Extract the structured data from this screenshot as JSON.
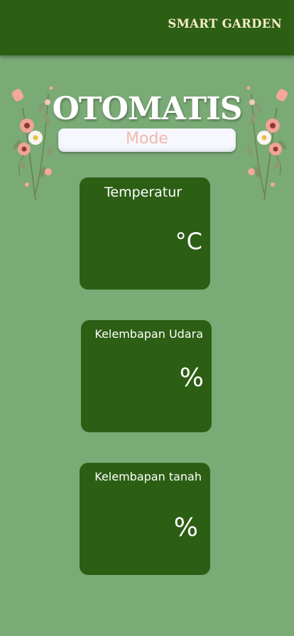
{
  "app_bar": {
    "title": "SMART GARDEN"
  },
  "mode": {
    "title": "OTOMATIS",
    "badge_label": "Mode"
  },
  "cards": [
    {
      "label": "Temperatur",
      "unit": "°C"
    },
    {
      "label": "Kelembapan Udara",
      "unit": "%"
    },
    {
      "label": "Kelembapan tanah",
      "unit": "%"
    }
  ],
  "colors": {
    "background": "#7aaa76",
    "app_bar": "#2c5e14",
    "card": "#2c5e14",
    "title_text": "#f7ecc8",
    "badge_text": "#f3b8ae"
  },
  "icons": [
    "flower-decoration-left",
    "flower-decoration-right"
  ]
}
